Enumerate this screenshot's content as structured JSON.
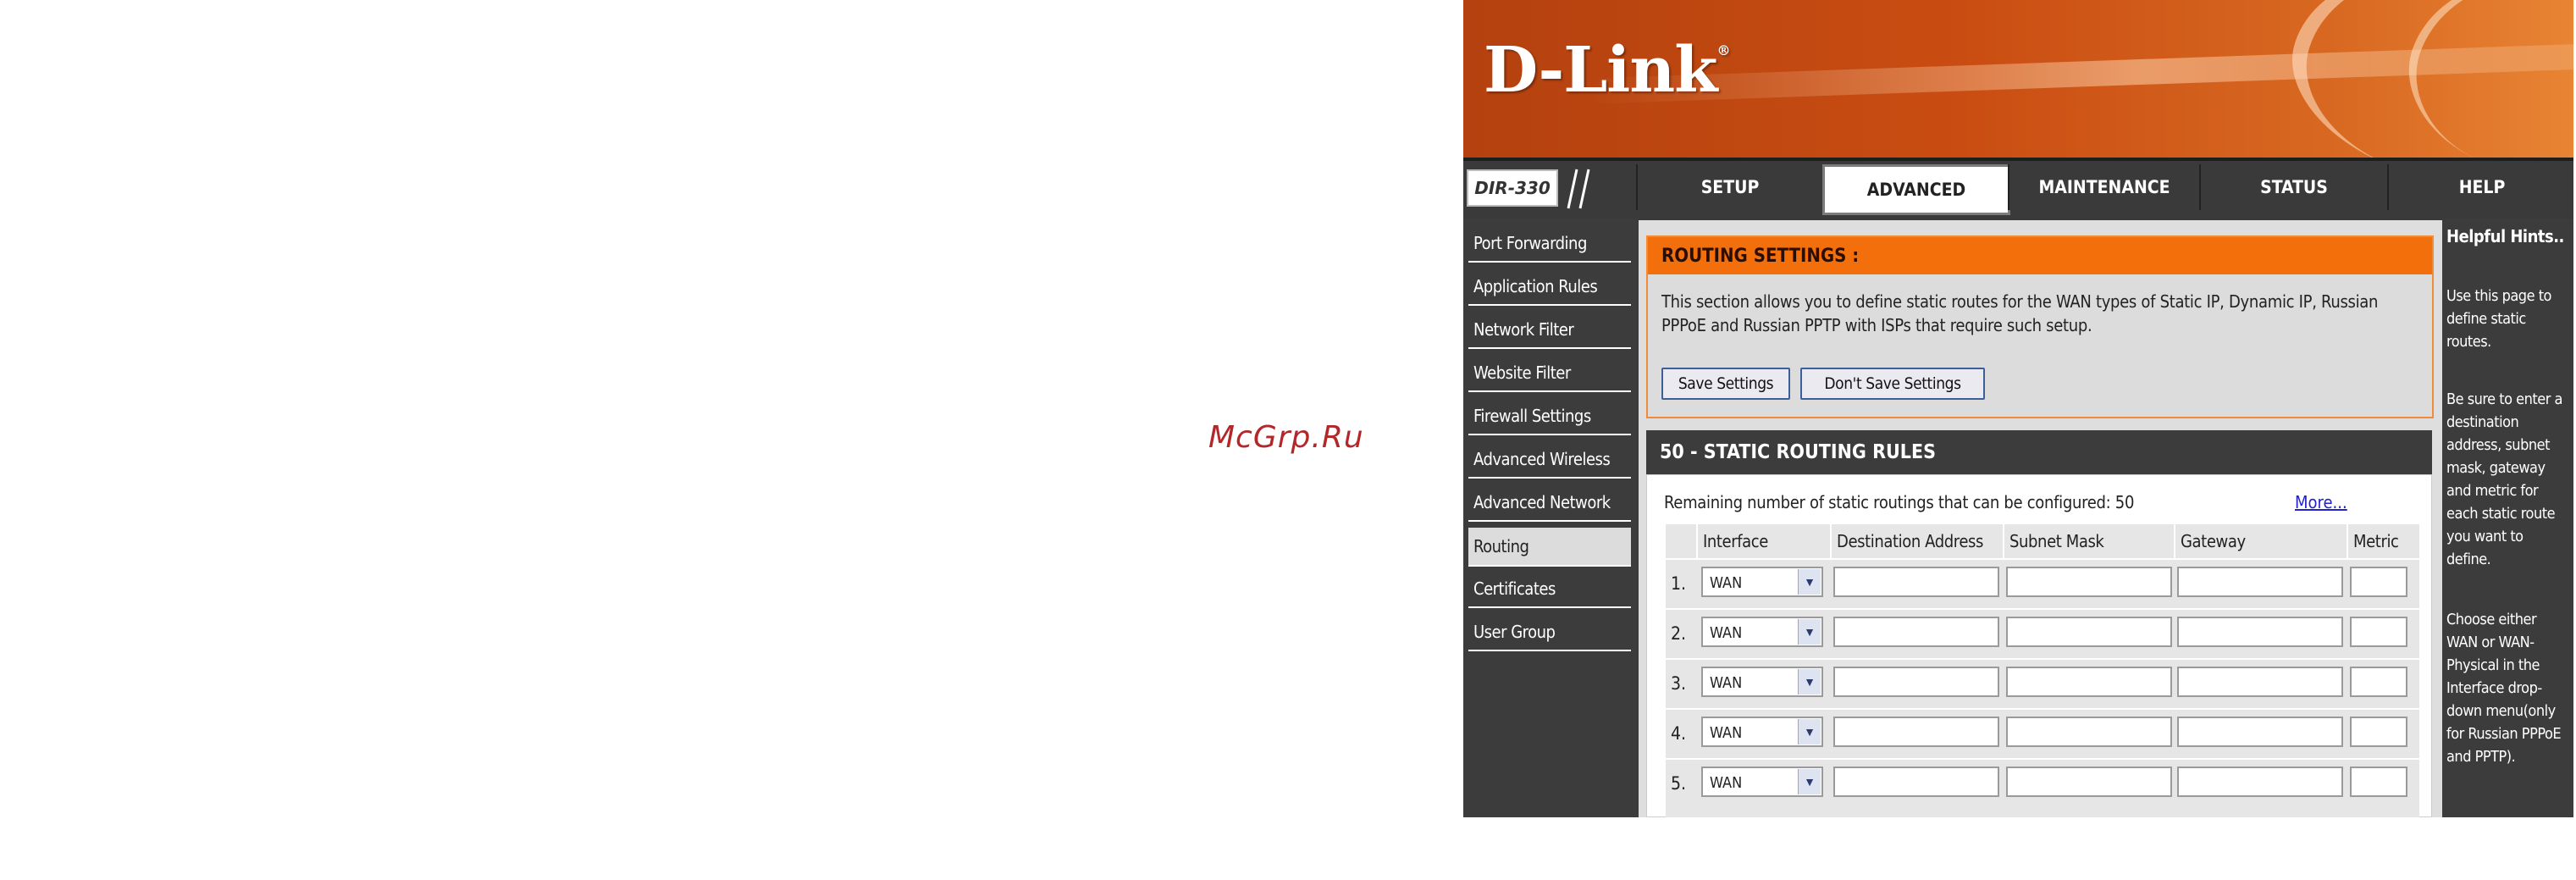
{
  "watermark": "McGrp.Ru",
  "brand": {
    "logo": "D-Link",
    "model": "DIR-330"
  },
  "tabs": [
    {
      "label": "SETUP",
      "active": false
    },
    {
      "label": "ADVANCED",
      "active": true
    },
    {
      "label": "MAINTENANCE",
      "active": false
    },
    {
      "label": "STATUS",
      "active": false
    },
    {
      "label": "HELP",
      "active": false
    }
  ],
  "sidebar": {
    "items": [
      {
        "label": "Port Forwarding",
        "active": false
      },
      {
        "label": "Application Rules",
        "active": false
      },
      {
        "label": "Network Filter",
        "active": false
      },
      {
        "label": "Website Filter",
        "active": false
      },
      {
        "label": "Firewall Settings",
        "active": false
      },
      {
        "label": "Advanced Wireless",
        "active": false
      },
      {
        "label": "Advanced Network",
        "active": false
      },
      {
        "label": "Routing",
        "active": true
      },
      {
        "label": "Certificates",
        "active": false
      },
      {
        "label": "User Group",
        "active": false
      }
    ]
  },
  "routing": {
    "title": "ROUTING SETTINGS :",
    "description": "This section allows you to define static routes for the WAN types of Static IP, Dynamic IP, Russian PPPoE and Russian PPTP with ISPs that require such setup.",
    "save_label": "Save Settings",
    "dont_save_label": "Don't Save Settings"
  },
  "rules": {
    "title": "50 - STATIC ROUTING RULES",
    "remaining": "Remaining number of static routings that can be configured: 50",
    "more_link": "More...",
    "columns": [
      "Interface",
      "Destination Address",
      "Subnet Mask",
      "Gateway",
      "Metric"
    ],
    "rows": [
      {
        "num": "1.",
        "interface": "WAN",
        "destination": "",
        "mask": "",
        "gateway": "",
        "metric": ""
      },
      {
        "num": "2.",
        "interface": "WAN",
        "destination": "",
        "mask": "",
        "gateway": "",
        "metric": ""
      },
      {
        "num": "3.",
        "interface": "WAN",
        "destination": "",
        "mask": "",
        "gateway": "",
        "metric": ""
      },
      {
        "num": "4.",
        "interface": "WAN",
        "destination": "",
        "mask": "",
        "gateway": "",
        "metric": ""
      },
      {
        "num": "5.",
        "interface": "WAN",
        "destination": "",
        "mask": "",
        "gateway": "",
        "metric": ""
      }
    ]
  },
  "help": {
    "title": "Helpful Hints..",
    "p1": "Use this page to define static routes.",
    "p2": "Be sure to enter a destination address, subnet mask, gateway and metric for each static route you want to define.",
    "p3": "Choose either WAN or WAN-Physical in the Interface drop-down menu(only for Russian PPPoE and PPTP)."
  },
  "colors": {
    "accent": "#f36f0c",
    "dark": "#3c3c3c",
    "link": "#2222cc"
  }
}
